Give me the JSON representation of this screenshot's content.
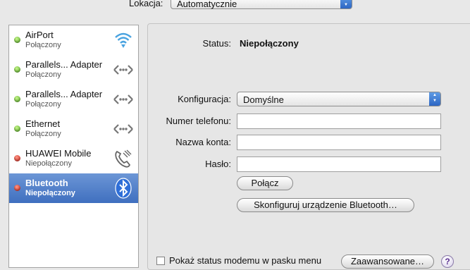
{
  "location": {
    "label": "Lokacja:",
    "value": "Automatycznie"
  },
  "services": [
    {
      "name": "AirPort",
      "status": "Połączony",
      "state": "green",
      "icon": "wifi-icon"
    },
    {
      "name": "Parallels... Adapter",
      "status": "Połączony",
      "state": "green",
      "icon": "ethernet-icon"
    },
    {
      "name": "Parallels... Adapter",
      "status": "Połączony",
      "state": "green",
      "icon": "ethernet-icon"
    },
    {
      "name": "Ethernet",
      "status": "Połączony",
      "state": "green",
      "icon": "ethernet-icon"
    },
    {
      "name": "HUAWEI Mobile",
      "status": "Niepołączony",
      "state": "red",
      "icon": "phone-icon"
    },
    {
      "name": "Bluetooth",
      "status": "Niepołączony",
      "state": "red",
      "icon": "bluetooth-icon",
      "selected": true
    }
  ],
  "detail": {
    "status_label": "Status:",
    "status_value": "Niepołączony",
    "config_label": "Konfiguracja:",
    "config_value": "Domyślne",
    "phone_label": "Numer telefonu:",
    "phone_value": "",
    "account_label": "Nazwa konta:",
    "account_value": "",
    "password_label": "Hasło:",
    "password_value": "",
    "connect_button": "Połącz",
    "configure_button": "Skonfiguruj urządzenie Bluetooth…",
    "show_status_label": "Pokaż status modemu w pasku menu",
    "advanced_button": "Zaawansowane…",
    "help_label": "?"
  },
  "colors": {
    "selection": "#4a78c6",
    "connected": "#4aa01d",
    "disconnected": "#c81a10"
  }
}
